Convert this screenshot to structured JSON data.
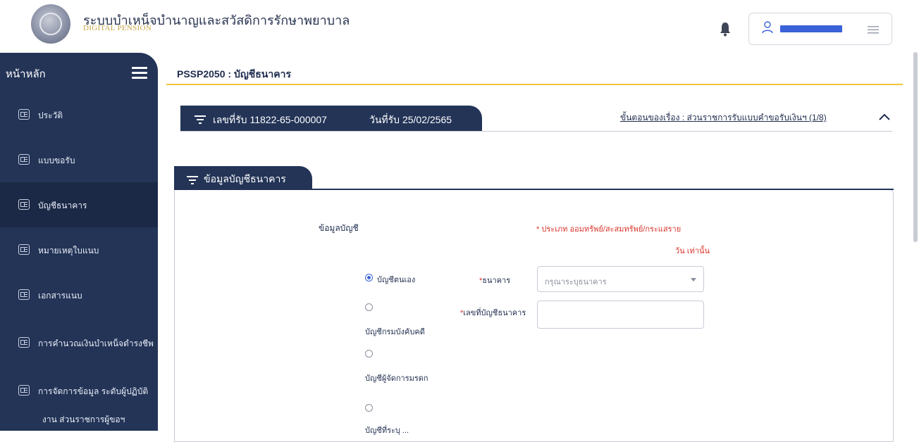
{
  "header": {
    "app_title": "ระบบบำเหน็จบำนาญและสวัสดิการรักษาพยาบาล",
    "app_subtitle": "DIGITAL PENSION",
    "icons": {
      "logo": "government-seal-logo",
      "bell": "bell-icon",
      "user": "user-icon",
      "menu": "menu-icon"
    }
  },
  "sidebar": {
    "home_label": "หน้าหลัก",
    "items": [
      {
        "label": "ประวัติ",
        "active": false
      },
      {
        "label": "แบบขอรับ",
        "active": false
      },
      {
        "label": "บัญชีธนาคาร",
        "active": true
      },
      {
        "label": "หมายเหตุใบแนบ",
        "active": false
      },
      {
        "label": "เอกสารแนบ",
        "active": false
      },
      {
        "label": "การคำนวณเงินบำเหน็จดำรงชีพ",
        "active": false
      },
      {
        "label": "การจัดการข้อมูล ระดับผู้ปฏิบัติ",
        "active": false
      },
      {
        "label": "งาน ส่วนราชการผู้ขอฯ",
        "active": false
      }
    ]
  },
  "main": {
    "page_title": "PSSP2050 : บัญชีธนาคาร",
    "record": {
      "receive_no": "เลขที่รับ 11822-65-000007",
      "receive_date": "วันที่รับ 25/02/2565"
    },
    "step_link": "ขั้นตอนของเรื่อง : ส่วนราชการรับแบบคำขอรับเงินฯ (1/8)",
    "section_tab": "ข้อมูลบัญชีธนาคาร",
    "form": {
      "section_label": "ข้อมูลบัญชี",
      "required_note_line1": "* ประเภท ออมทรัพย์/สะสมทรัพย์/กระแสราย",
      "required_note_line2": "วัน เท่านั้น",
      "options": [
        {
          "label": "บัญชีตนเอง",
          "checked": true
        },
        {
          "label": "บัญชีกรมบังคับคดี",
          "checked": false
        },
        {
          "label": "บัญชีผู้จัดการมรดก",
          "checked": false
        },
        {
          "label": "บัญชีที่ระบุ ...",
          "checked": false
        }
      ],
      "bank_label": "ธนาคาร",
      "bank_placeholder": "กรุณาระบุธนาคาร",
      "account_label": "เลขที่บัญชีธนาคาร",
      "account_value": ""
    }
  },
  "colors": {
    "navy": "#233457",
    "accent_yellow": "#f0c53a",
    "required_red": "#d9342b",
    "radio_blue": "#3a62d8"
  }
}
